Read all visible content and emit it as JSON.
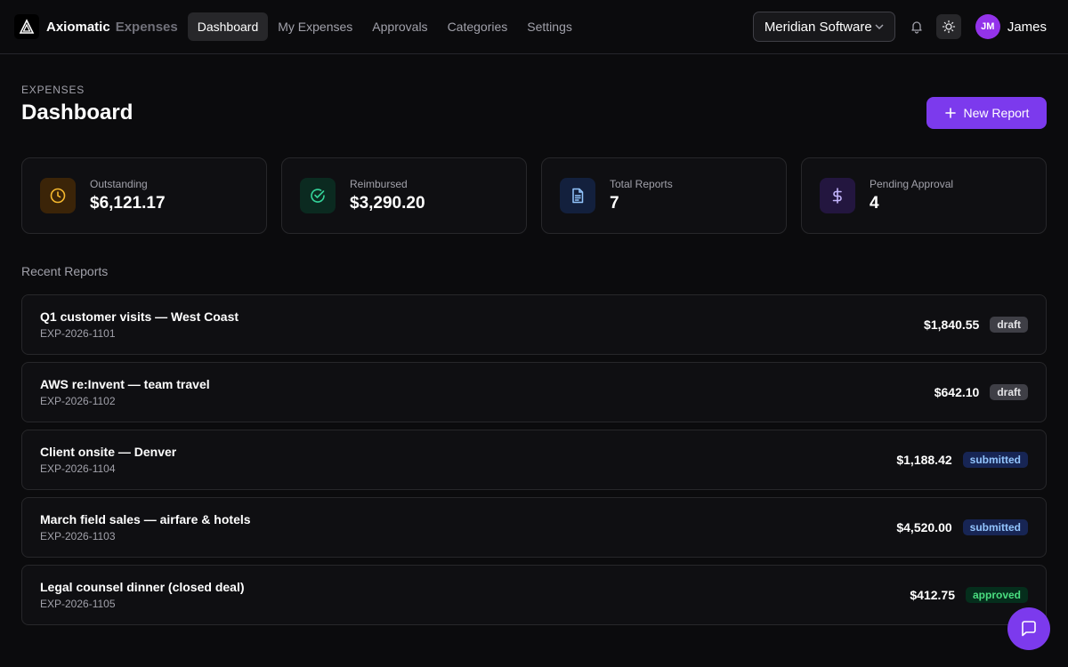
{
  "header": {
    "brand": "Axiomatic",
    "brand_sub": "Expenses",
    "nav": [
      {
        "label": "Dashboard",
        "active": true
      },
      {
        "label": "My Expenses",
        "active": false
      },
      {
        "label": "Approvals",
        "active": false
      },
      {
        "label": "Categories",
        "active": false
      },
      {
        "label": "Settings",
        "active": false
      }
    ],
    "org_select": "Meridian Software",
    "user_initials": "JM",
    "user_name": "James"
  },
  "page": {
    "eyebrow": "Expenses",
    "title": "Dashboard",
    "new_report_label": "New Report"
  },
  "stats": [
    {
      "label": "Outstanding",
      "value": "$6,121.17",
      "icon": "clock-icon",
      "icon_color": "#f5b82e",
      "icon_bg": "#3b2408"
    },
    {
      "label": "Reimbursed",
      "value": "$3,290.20",
      "icon": "check-circle-icon",
      "icon_color": "#34d399",
      "icon_bg": "#0b2a20"
    },
    {
      "label": "Total Reports",
      "value": "7",
      "icon": "file-text-icon",
      "icon_color": "#93c5fd",
      "icon_bg": "#13203d"
    },
    {
      "label": "Pending Approval",
      "value": "4",
      "icon": "dollar-icon",
      "icon_color": "#c4b5fd",
      "icon_bg": "#23163f"
    }
  ],
  "recent": {
    "title": "Recent Reports",
    "reports": [
      {
        "title": "Q1 customer visits — West Coast",
        "id": "EXP-2026-1101",
        "amount": "$1,840.55",
        "status": "draft"
      },
      {
        "title": "AWS re:Invent — team travel",
        "id": "EXP-2026-1102",
        "amount": "$642.10",
        "status": "draft"
      },
      {
        "title": "Client onsite — Denver",
        "id": "EXP-2026-1104",
        "amount": "$1,188.42",
        "status": "submitted"
      },
      {
        "title": "March field sales — airfare & hotels",
        "id": "EXP-2026-1103",
        "amount": "$4,520.00",
        "status": "submitted"
      },
      {
        "title": "Legal counsel dinner (closed deal)",
        "id": "EXP-2026-1105",
        "amount": "$412.75",
        "status": "approved"
      }
    ]
  }
}
